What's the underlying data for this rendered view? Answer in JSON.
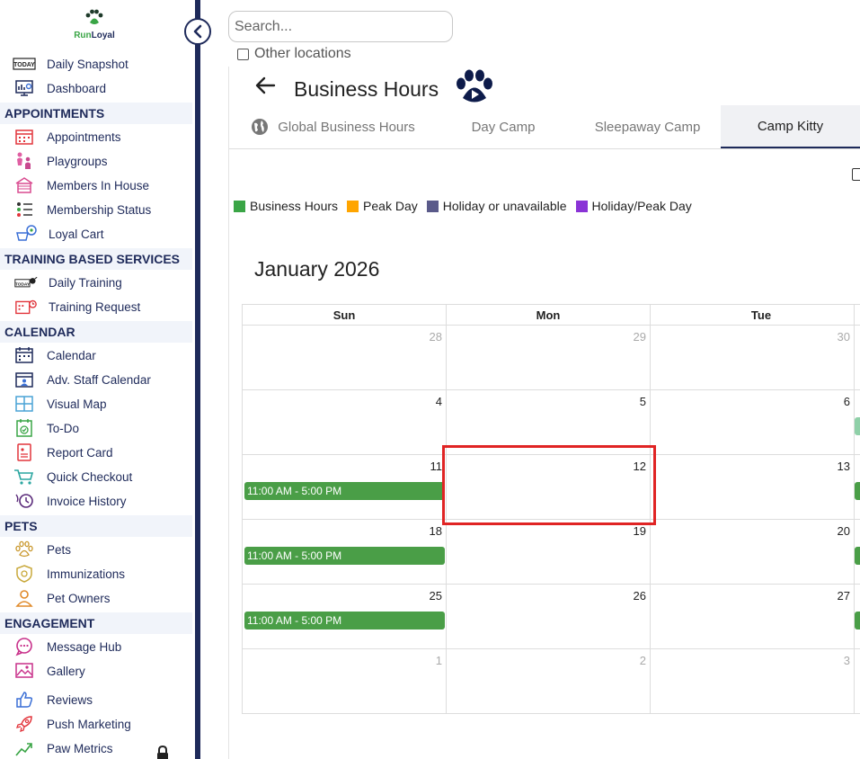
{
  "sidebar": {
    "logo_text_run": "Run",
    "logo_text_loyal": "Loyal",
    "items_top": [
      {
        "label": "Daily Snapshot",
        "icon": "today-calendar-icon"
      },
      {
        "label": "Dashboard",
        "icon": "dashboard-icon"
      }
    ],
    "sections": [
      {
        "title": "APPOINTMENTS",
        "items": [
          {
            "label": "Appointments",
            "icon": "appointments-calendar-icon"
          },
          {
            "label": "Playgroups",
            "icon": "playgroups-icon"
          },
          {
            "label": "Members In House",
            "icon": "house-icon"
          },
          {
            "label": "Membership Status",
            "icon": "membership-status-icon"
          },
          {
            "label": "Loyal Cart",
            "icon": "cart-icon"
          }
        ]
      },
      {
        "title": "TRAINING BASED SERVICES",
        "items": [
          {
            "label": "Daily Training",
            "icon": "daily-training-icon"
          },
          {
            "label": "Training Request",
            "icon": "training-request-icon"
          }
        ]
      },
      {
        "title": "CALENDAR",
        "items": [
          {
            "label": "Calendar",
            "icon": "calendar-icon"
          },
          {
            "label": "Adv. Staff Calendar",
            "icon": "staff-calendar-icon"
          },
          {
            "label": "Visual Map",
            "icon": "map-grid-icon"
          },
          {
            "label": "To-Do",
            "icon": "todo-icon"
          },
          {
            "label": "Report Card",
            "icon": "report-card-icon"
          },
          {
            "label": "Quick Checkout",
            "icon": "checkout-cart-icon"
          },
          {
            "label": "Invoice History",
            "icon": "invoice-history-icon"
          }
        ]
      },
      {
        "title": "PETS",
        "items": [
          {
            "label": "Pets",
            "icon": "paw-icon"
          },
          {
            "label": "Immunizations",
            "icon": "shield-icon"
          },
          {
            "label": "Pet Owners",
            "icon": "person-icon"
          }
        ]
      },
      {
        "title": "ENGAGEMENT",
        "items": [
          {
            "label": "Message Hub",
            "icon": "chat-bubble-icon"
          },
          {
            "label": "Gallery",
            "icon": "gallery-icon"
          },
          {
            "label": "Reviews",
            "icon": "thumbs-up-icon"
          },
          {
            "label": "Push Marketing",
            "icon": "rocket-icon"
          },
          {
            "label": "Paw Metrics",
            "icon": "trend-chart-icon"
          }
        ]
      }
    ]
  },
  "search": {
    "placeholder": "Search..."
  },
  "other_locations_label": "Other locations",
  "page_title": "Business Hours",
  "tabs": [
    {
      "label": "Global Business Hours",
      "icon": "globe-icon",
      "active": false
    },
    {
      "label": "Day Camp",
      "active": false
    },
    {
      "label": "Sleepaway Camp",
      "active": false
    },
    {
      "label": "Camp Kitty",
      "active": true
    }
  ],
  "legend": [
    {
      "label": "Business Hours",
      "color": "#3aa546"
    },
    {
      "label": "Peak Day",
      "color": "#ffa500"
    },
    {
      "label": "Holiday or unavailable",
      "color": "#5a5a8a"
    },
    {
      "label": "Holiday/Peak Day",
      "color": "#8a33d6"
    }
  ],
  "calendar": {
    "month_title": "January 2026",
    "weekdays": [
      "Sun",
      "Mon",
      "Tue"
    ],
    "weeks": [
      [
        {
          "day": "28",
          "other": true
        },
        {
          "day": "29",
          "other": true
        },
        {
          "day": "30",
          "other": true
        }
      ],
      [
        {
          "day": "4"
        },
        {
          "day": "5"
        },
        {
          "day": "6"
        }
      ],
      [
        {
          "day": "11",
          "event": "11:00 AM - 5:00 PM"
        },
        {
          "day": "12"
        },
        {
          "day": "13"
        }
      ],
      [
        {
          "day": "18",
          "event": "11:00 AM - 5:00 PM"
        },
        {
          "day": "19"
        },
        {
          "day": "20"
        }
      ],
      [
        {
          "day": "25",
          "event": "11:00 AM - 5:00 PM"
        },
        {
          "day": "26"
        },
        {
          "day": "27"
        }
      ],
      [
        {
          "day": "1",
          "other": true
        },
        {
          "day": "2",
          "other": true
        },
        {
          "day": "3",
          "other": true
        }
      ]
    ],
    "highlighted_day": "12"
  }
}
